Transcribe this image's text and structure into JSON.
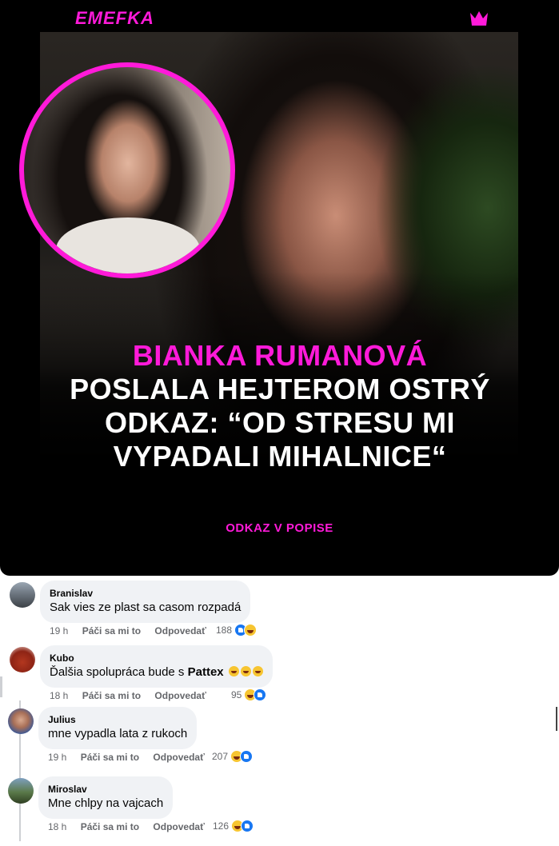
{
  "post_image": {
    "brand": "EMEFKA",
    "headline_name": "BIANKA RUMANOVÁ",
    "headline_rest": "POSLALA HEJTEROM OSTRÝ ODKAZ: “OD STRESU MI VYPADALI MIHALNICE“",
    "footer_tag": "ODKAZ V POPISE",
    "accent_color": "#ff1ad9"
  },
  "comments": [
    {
      "author": "Branislav",
      "text": "Sak vies ze plast sa casom rozpadá",
      "time": "19 h",
      "like_label": "Páči sa mi to",
      "reply_label": "Odpovedať",
      "reaction_count": "188",
      "reactions": [
        "like-icon",
        "haha-icon"
      ]
    },
    {
      "author": "Kubo",
      "text_before": "Ďalšia spolupráca bude s ",
      "text_bold": "Pattex",
      "text_emojis": [
        "rofl-emoji",
        "rofl-emoji",
        "rofl-emoji"
      ],
      "time": "18 h",
      "like_label": "Páči sa mi to",
      "reply_label": "Odpovedať",
      "reaction_count": "95",
      "reactions": [
        "haha-icon",
        "like-icon"
      ]
    },
    {
      "author": "Julius",
      "text": "mne vypadla lata z rukoch",
      "time": "19 h",
      "like_label": "Páči sa mi to",
      "reply_label": "Odpovedať",
      "reaction_count": "207",
      "reactions": [
        "haha-icon",
        "like-icon"
      ]
    },
    {
      "author": "Miroslav",
      "text": "Mne chlpy na vajcach",
      "time": "18 h",
      "like_label": "Páči sa mi to",
      "reply_label": "Odpovedať",
      "reaction_count": "126",
      "reactions": [
        "haha-icon",
        "like-icon"
      ]
    }
  ]
}
